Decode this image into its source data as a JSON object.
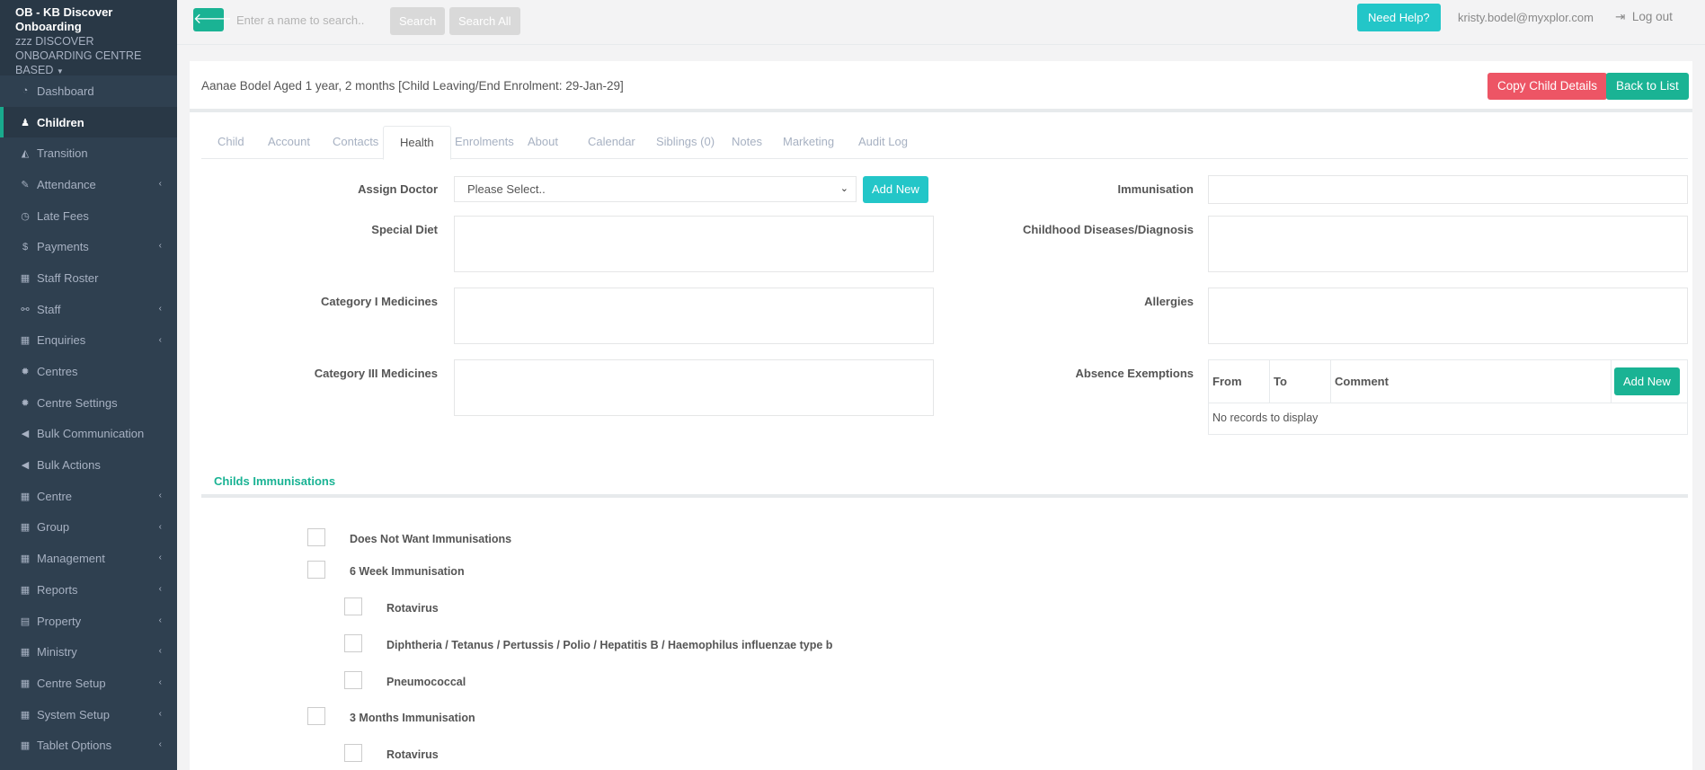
{
  "sidebar": {
    "org": "OB - KB Discover Onboarding",
    "centre": "zzz DISCOVER ONBOARDING CENTRE BASED",
    "items": [
      {
        "label": "Dashboard",
        "icon": "pie-chart-icon",
        "glyph": "◔",
        "arrow": false,
        "active": false
      },
      {
        "label": "Children",
        "icon": "child-icon",
        "glyph": "♟",
        "arrow": false,
        "active": true
      },
      {
        "label": "Transition",
        "icon": "graduation-cap-icon",
        "glyph": "◭",
        "arrow": false,
        "active": false
      },
      {
        "label": "Attendance",
        "icon": "edit-icon",
        "glyph": "✎",
        "arrow": true,
        "active": false
      },
      {
        "label": "Late Fees",
        "icon": "clock-icon",
        "glyph": "◷",
        "arrow": false,
        "active": false
      },
      {
        "label": "Payments",
        "icon": "dollar-icon",
        "glyph": "$",
        "arrow": true,
        "active": false
      },
      {
        "label": "Staff Roster",
        "icon": "calendar-icon",
        "glyph": "▦",
        "arrow": false,
        "active": false
      },
      {
        "label": "Staff",
        "icon": "sitemap-icon",
        "glyph": "⚯",
        "arrow": true,
        "active": false
      },
      {
        "label": "Enquiries",
        "icon": "grid-icon",
        "glyph": "▦",
        "arrow": true,
        "active": false
      },
      {
        "label": "Centres",
        "icon": "gear-icon",
        "glyph": "✹",
        "arrow": false,
        "active": false
      },
      {
        "label": "Centre Settings",
        "icon": "gear-icon",
        "glyph": "✹",
        "arrow": false,
        "active": false
      },
      {
        "label": "Bulk Communication",
        "icon": "bullhorn-icon",
        "glyph": "◀",
        "arrow": false,
        "active": false
      },
      {
        "label": "Bulk Actions",
        "icon": "bullhorn-icon",
        "glyph": "◀",
        "arrow": false,
        "active": false
      },
      {
        "label": "Centre",
        "icon": "grid-icon",
        "glyph": "▦",
        "arrow": true,
        "active": false
      },
      {
        "label": "Group",
        "icon": "grid-icon",
        "glyph": "▦",
        "arrow": true,
        "active": false
      },
      {
        "label": "Management",
        "icon": "grid-icon",
        "glyph": "▦",
        "arrow": true,
        "active": false
      },
      {
        "label": "Reports",
        "icon": "grid-icon",
        "glyph": "▦",
        "arrow": true,
        "active": false
      },
      {
        "label": "Property",
        "icon": "building-icon",
        "glyph": "▤",
        "arrow": true,
        "active": false
      },
      {
        "label": "Ministry",
        "icon": "grid-icon",
        "glyph": "▦",
        "arrow": true,
        "active": false
      },
      {
        "label": "Centre Setup",
        "icon": "grid-icon",
        "glyph": "▦",
        "arrow": true,
        "active": false
      },
      {
        "label": "System Setup",
        "icon": "grid-icon",
        "glyph": "▦",
        "arrow": true,
        "active": false
      },
      {
        "label": "Tablet Options",
        "icon": "grid-icon",
        "glyph": "▦",
        "arrow": true,
        "active": false
      }
    ]
  },
  "topbar": {
    "search_placeholder": "Enter a name to search..",
    "search_label": "Search",
    "search_all_label": "Search All",
    "help_label": "Need Help?",
    "user_email": "kristy.bodel@myxplor.com",
    "logout_label": "Log out"
  },
  "child": {
    "title": "Aanae Bodel Aged 1 year, 2 months [Child Leaving/End Enrolment: 29-Jan-29]",
    "copy_label": "Copy Child Details",
    "back_label": "Back to List"
  },
  "tabs": [
    "Child",
    "Account",
    "Contacts",
    "Health",
    "Enrolments",
    "About",
    "Calendar",
    "Siblings (0)",
    "Notes",
    "Marketing",
    "Audit Log"
  ],
  "active_tab": "Health",
  "health": {
    "assign_doctor_label": "Assign Doctor",
    "doctor_select_value": "Please Select..",
    "add_new_label": "Add New",
    "special_diet_label": "Special Diet",
    "cat1_label": "Category I Medicines",
    "cat3_label": "Category III Medicines",
    "immunisation_label": "Immunisation",
    "diseases_label": "Childhood Diseases/Diagnosis",
    "allergies_label": "Allergies",
    "absence_label": "Absence Exemptions",
    "absence_cols": [
      "From",
      "To",
      "Comment"
    ],
    "absence_add_label": "Add New",
    "absence_empty": "No records to display"
  },
  "immunisations": {
    "title": "Childs Immunisations",
    "items": [
      {
        "label": "Does Not Want Immunisations",
        "level": 0
      },
      {
        "label": "6 Week Immunisation",
        "level": 0
      },
      {
        "label": "Rotavirus",
        "level": 1
      },
      {
        "label": "Diphtheria / Tetanus / Pertussis / Polio / Hepatitis B / Haemophilus influenzae type b",
        "level": 1
      },
      {
        "label": "Pneumococcal",
        "level": 1
      },
      {
        "label": "3 Months Immunisation",
        "level": 0
      },
      {
        "label": "Rotavirus",
        "level": 1
      }
    ]
  }
}
